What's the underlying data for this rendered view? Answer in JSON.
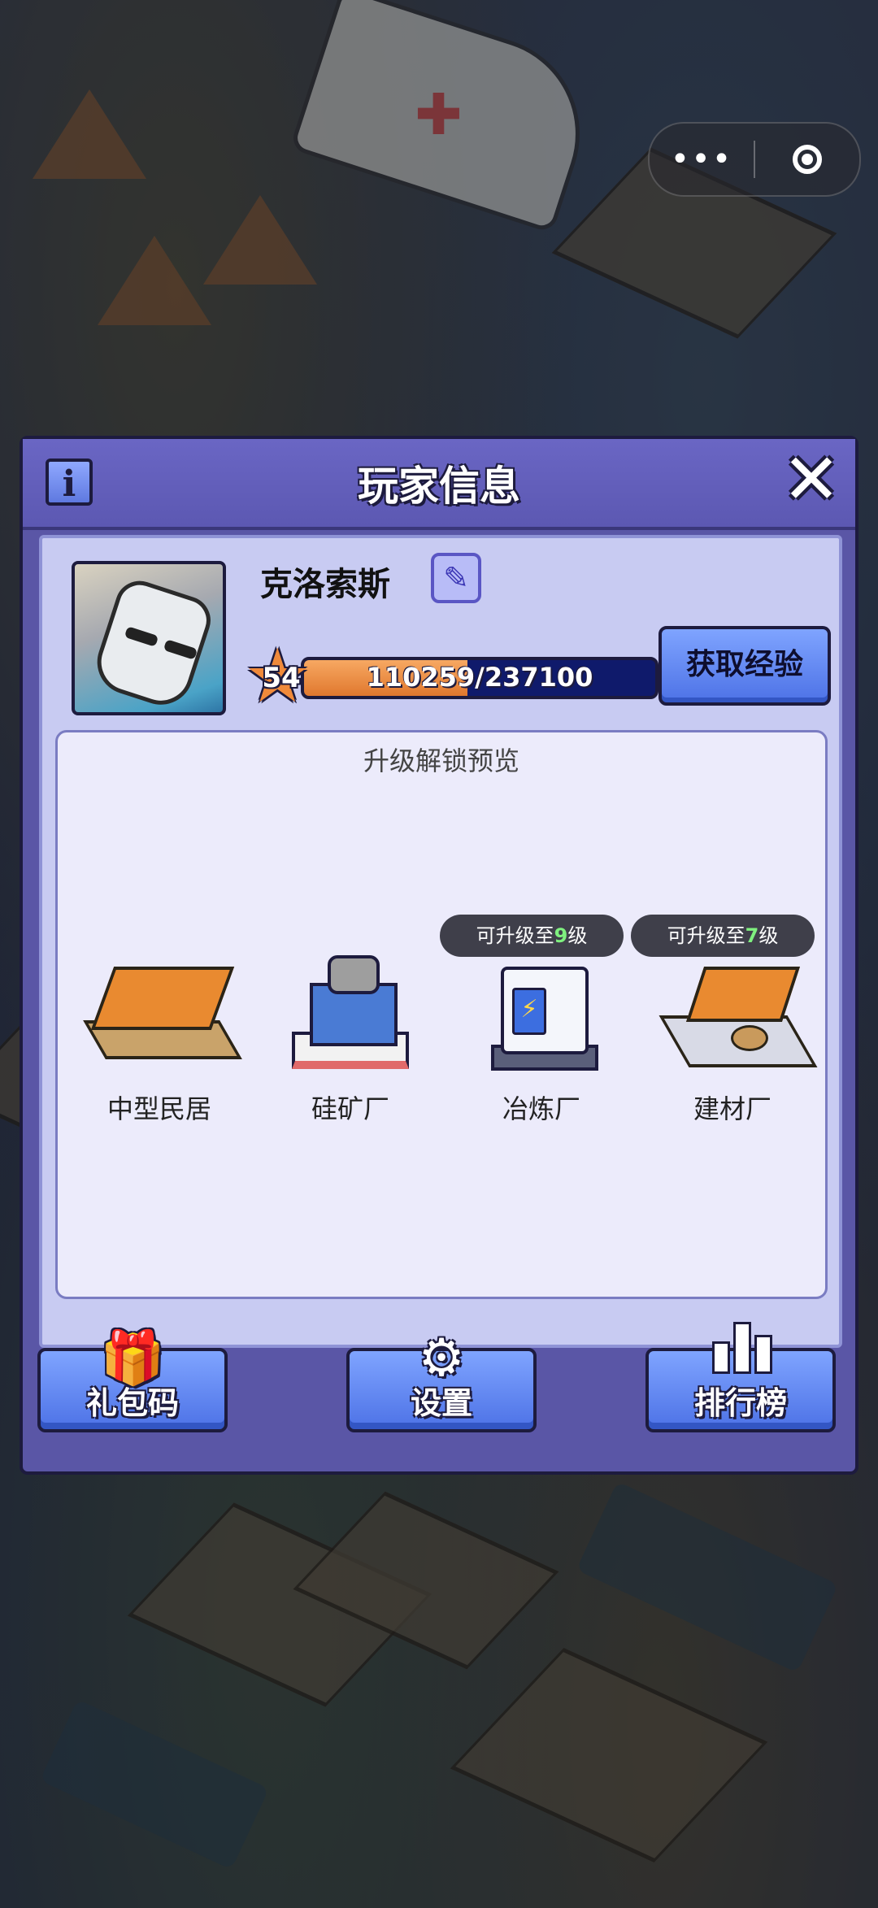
{
  "capsule": {
    "more_glyph": "•••",
    "more_icon": "more-dots-icon",
    "close_icon": "target-circle-icon"
  },
  "dialog": {
    "title": "玩家信息",
    "info_glyph": "i",
    "close_glyph": "✕",
    "player": {
      "name": "克洛索斯",
      "edit_glyph": "✎",
      "level": "54",
      "xp_text": "110259/237100",
      "xp_current": 110259,
      "xp_max": 237100,
      "get_exp_label": "获取经验"
    },
    "preview": {
      "title": "升级解锁预览",
      "buildings": [
        {
          "name": "中型民居",
          "badge": null
        },
        {
          "name": "硅矿厂",
          "badge": null
        },
        {
          "name": "冶炼厂",
          "badge": {
            "prefix": "可升级至",
            "level": "9",
            "suffix": "级"
          }
        },
        {
          "name": "建材厂",
          "badge": {
            "prefix": "可升级至",
            "level": "7",
            "suffix": "级"
          }
        }
      ]
    },
    "buttons": {
      "gift_code": {
        "label": "礼包码",
        "icon": "gift-icon"
      },
      "settings": {
        "label": "设置",
        "icon": "gear-icon"
      },
      "leaderboard": {
        "label": "排行榜",
        "icon": "bar-chart-icon"
      }
    }
  },
  "colors": {
    "dialog_bg": "#5a56a6",
    "inner_bg": "#c8cbf2",
    "button_blue": "#5f84f0",
    "xp_fill": "#e98a3c",
    "xp_track": "#0f1a6b"
  }
}
